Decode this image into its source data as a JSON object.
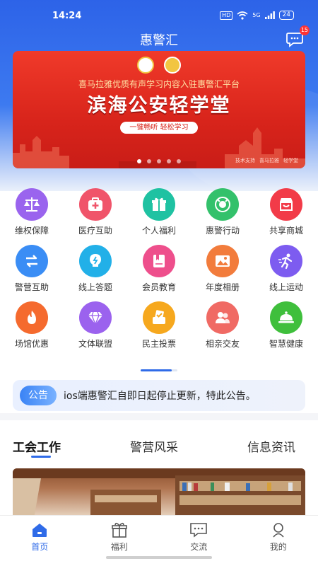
{
  "status_bar": {
    "time": "14:24",
    "hd": "HD",
    "network": "5G",
    "battery": "24"
  },
  "header": {
    "title": "惠警汇",
    "message_badge": "15"
  },
  "banner": {
    "subtitle": "喜马拉雅优质有声学习内容入驻惠警汇平台",
    "headline": "滨海公安轻学堂",
    "pill": "一键畅听 轻松学习",
    "credit_support": "技术支持",
    "credit_brand": "喜马拉雅",
    "credit_product": "轻学堂",
    "slides": 5,
    "active_slide": 1
  },
  "grid": [
    [
      {
        "label": "维权保障",
        "icon": "scales-icon",
        "color": "#9a64ee"
      },
      {
        "label": "医疗互助",
        "icon": "medical-kit-icon",
        "color": "#f0546a"
      },
      {
        "label": "个人福利",
        "icon": "gift-icon",
        "color": "#1fc2a2"
      },
      {
        "label": "惠警行动",
        "icon": "police-emblem-icon",
        "color": "#33c16b"
      },
      {
        "label": "共享商城",
        "icon": "shop-icon",
        "color": "#f23b48"
      }
    ],
    [
      {
        "label": "警营互助",
        "icon": "exchange-icon",
        "color": "#3a8df5"
      },
      {
        "label": "线上答题",
        "icon": "lightbulb-icon",
        "color": "#22b0e8"
      },
      {
        "label": "会员教育",
        "icon": "book-icon",
        "color": "#ee4f8c"
      },
      {
        "label": "年度相册",
        "icon": "photo-icon",
        "color": "#f27c3c"
      },
      {
        "label": "线上运动",
        "icon": "running-icon",
        "color": "#7d5cf0"
      }
    ],
    [
      {
        "label": "场馆优惠",
        "icon": "flame-icon",
        "color": "#f56a2e"
      },
      {
        "label": "文体联盟",
        "icon": "diamond-icon",
        "color": "#9b62ee"
      },
      {
        "label": "民主投票",
        "icon": "vote-icon",
        "color": "#f6a81e"
      },
      {
        "label": "相亲交友",
        "icon": "people-icon",
        "color": "#f06a64"
      },
      {
        "label": "智慧健康",
        "icon": "food-cover-icon",
        "color": "#3fbf3c"
      }
    ]
  ],
  "notice": {
    "tag": "公告",
    "text": "ios端惠警汇自即日起停止更新，特此公告。"
  },
  "tabs": [
    "工会工作",
    "警营风采",
    "信息资讯"
  ],
  "active_tab": 0,
  "bottom_nav": [
    {
      "label": "首页",
      "icon": "home-icon",
      "active": true
    },
    {
      "label": "福利",
      "icon": "gift-icon",
      "active": false
    },
    {
      "label": "交流",
      "icon": "chat-icon",
      "active": false
    },
    {
      "label": "我的",
      "icon": "user-icon",
      "active": false
    }
  ],
  "colors": {
    "primary": "#2f6be8",
    "banner_red": "#d8241b"
  }
}
